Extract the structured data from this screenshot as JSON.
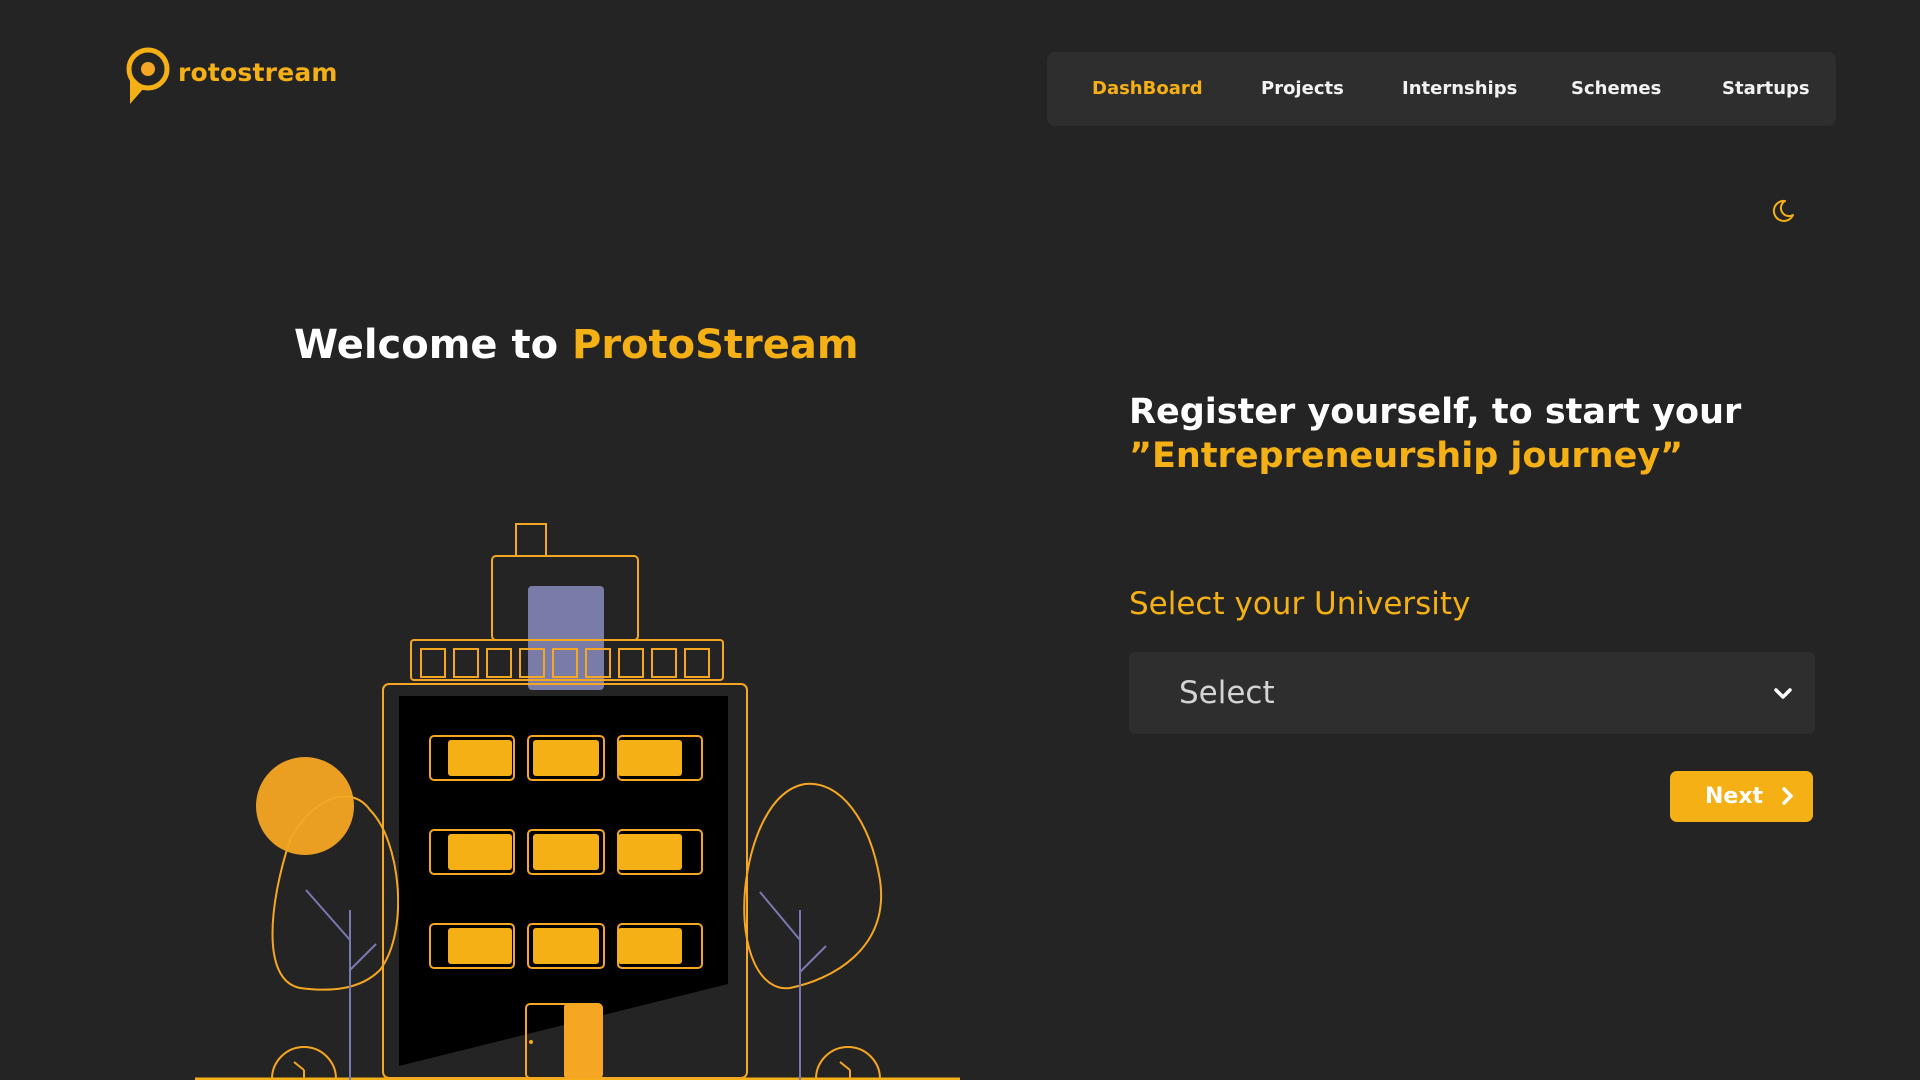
{
  "app": {
    "logo_text": "rotostream",
    "accent_color": "#f5b016",
    "background_color": "#242424",
    "logo_icon": "location-pin-p-icon"
  },
  "nav": {
    "items": [
      {
        "label": "DashBoard",
        "active": true
      },
      {
        "label": "Projects",
        "active": false
      },
      {
        "label": "Internships",
        "active": false
      },
      {
        "label": "Schemes",
        "active": false
      },
      {
        "label": "Startups",
        "active": false
      }
    ],
    "theme_toggle_icon": "moon-icon"
  },
  "hero": {
    "welcome_prefix": "Welcome to ",
    "welcome_brand": "ProtoStream",
    "illustration": "building-with-trees-and-sun"
  },
  "register": {
    "headline_line1": "Register yourself, to start your",
    "headline_line2": "”Entrepreneurship journey”",
    "select_label": "Select your University",
    "select_value": "Select",
    "select_icon": "chevron-down-icon",
    "next_label": "Next",
    "next_icon": "chevron-right-icon"
  }
}
